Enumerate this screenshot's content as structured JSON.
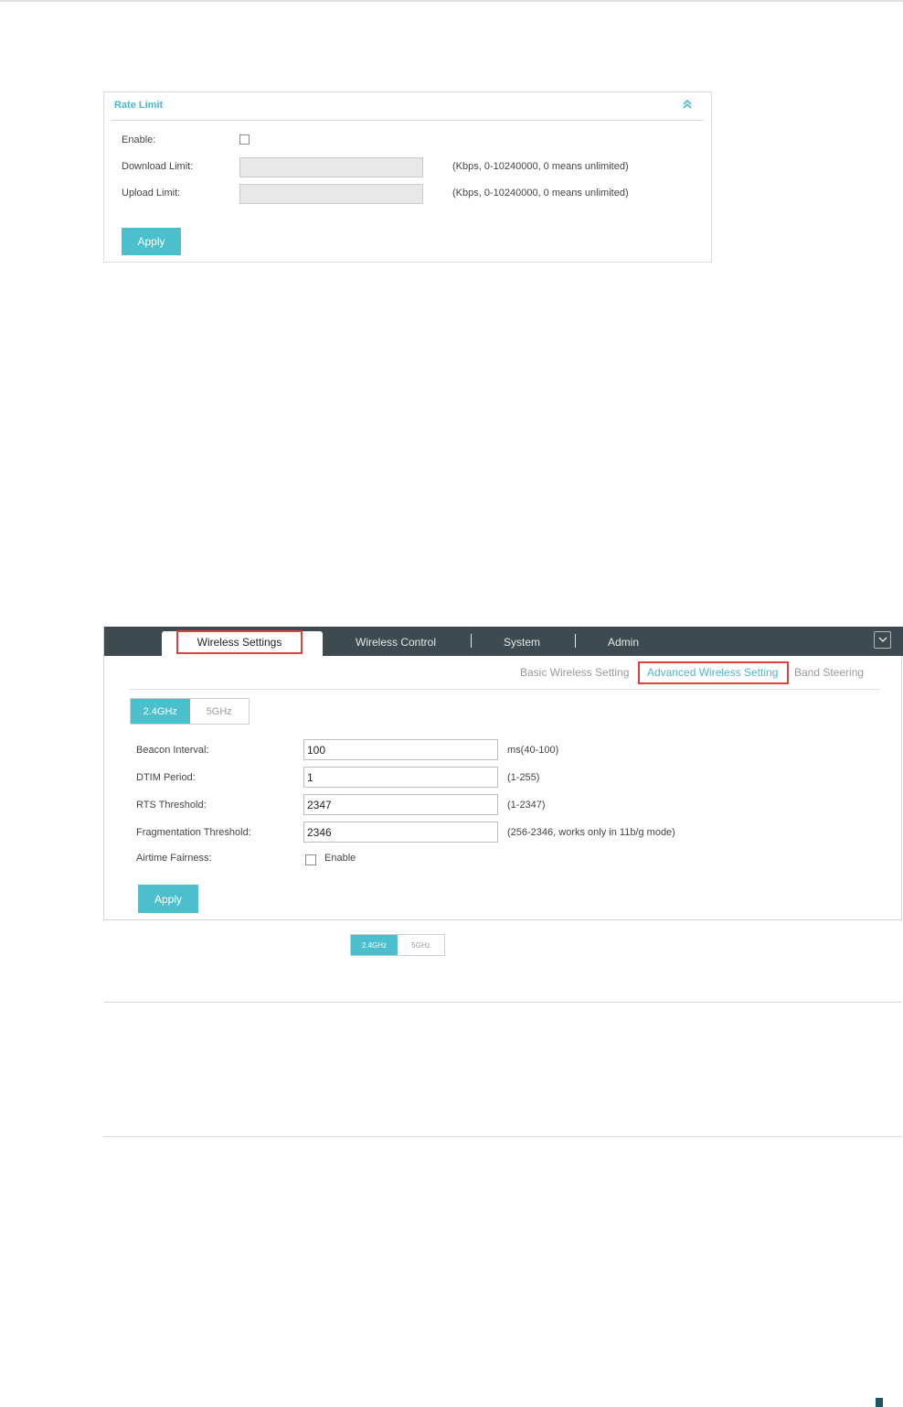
{
  "rate_limit": {
    "title": "Rate Limit",
    "enable_label": "Enable:",
    "download_label": "Download Limit:",
    "download_value": "",
    "download_hint": "(Kbps, 0-10240000, 0 means unlimited)",
    "upload_label": "Upload Limit:",
    "upload_value": "",
    "upload_hint": "(Kbps, 0-10240000, 0 means unlimited)",
    "apply_label": "Apply",
    "enabled": false
  },
  "wireless": {
    "nav": {
      "active_tab": "Wireless Settings",
      "tabs": [
        "Wireless Control",
        "System",
        "Admin"
      ]
    },
    "subnav": {
      "basic": "Basic Wireless Setting",
      "advanced": "Advanced Wireless Setting",
      "band": "Band Steering"
    },
    "bands": [
      "2.4GHz",
      "5GHz"
    ],
    "fields": {
      "beacon": {
        "label": "Beacon Interval:",
        "value": "100",
        "hint": "ms(40-100)"
      },
      "dtim": {
        "label": "DTIM Period:",
        "value": "1",
        "hint": "(1-255)"
      },
      "rts": {
        "label": "RTS Threshold:",
        "value": "2347",
        "hint": "(1-2347)"
      },
      "frag": {
        "label": "Fragmentation Threshold:",
        "value": "2346",
        "hint": "(256-2346, works only in 11b/g mode)"
      }
    },
    "airtime": {
      "label": "Airtime Fairness:",
      "check_label": "Enable",
      "enabled": false
    },
    "apply_label": "Apply"
  },
  "small_toggle": [
    "2.4GHz",
    "5GHz"
  ],
  "colors": {
    "accent": "#4bbfcb",
    "highlight": "#d9453d",
    "nav_bg": "#3d4a50"
  }
}
